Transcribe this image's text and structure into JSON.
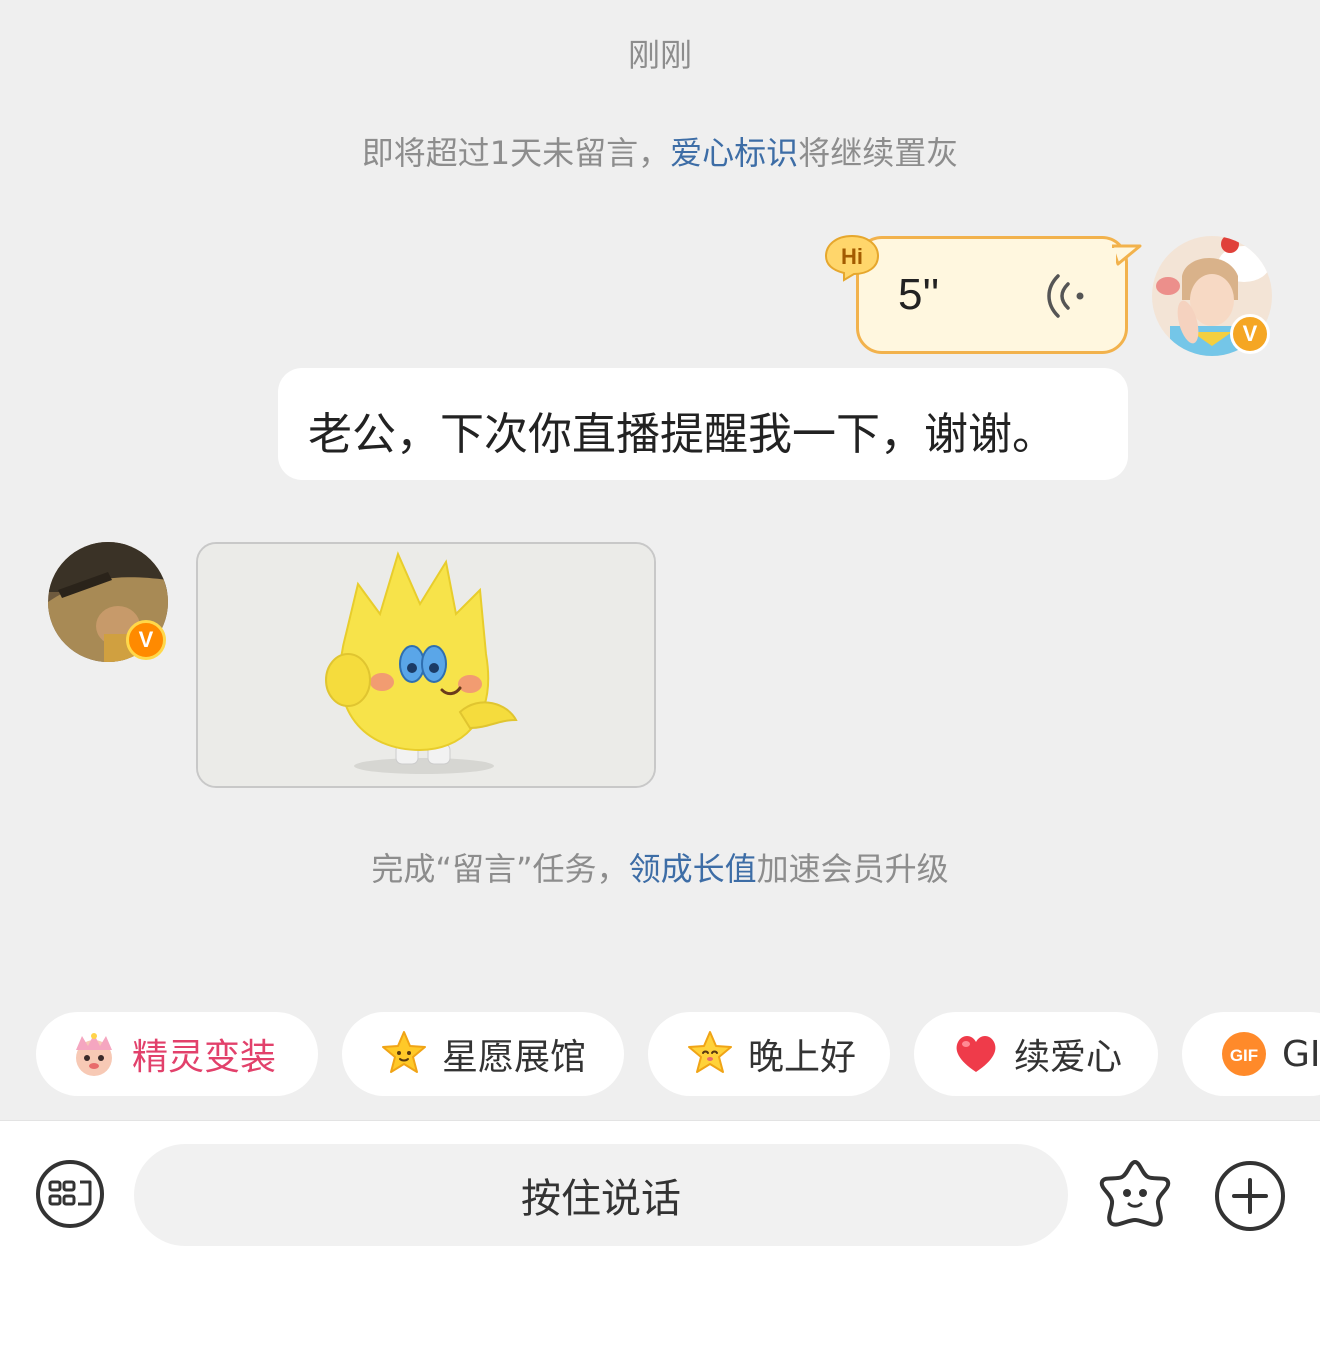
{
  "timestamp": "刚刚",
  "notice": {
    "prefix": "即将超过1天未留言，",
    "link": "爱心标识",
    "suffix": "将继续置灰"
  },
  "messages": {
    "voice": {
      "badge": "Hi",
      "duration": "5''"
    },
    "text": "老公，下次你直播提醒我一下，谢谢。",
    "verify_mark": "V"
  },
  "task_notice": {
    "prefix": "完成“留言”任务，",
    "link": "领成长值",
    "suffix": "加速会员升级"
  },
  "quick_actions": [
    {
      "label": "精灵变装",
      "icon": "sprite-costume-icon"
    },
    {
      "label": "星愿展馆",
      "icon": "star-icon"
    },
    {
      "label": "晚上好",
      "icon": "star-face-icon"
    },
    {
      "label": "续爱心",
      "icon": "heart-icon"
    },
    {
      "label": "GIF",
      "icon": "gif-icon",
      "icon_text": "GIF"
    }
  ],
  "input_bar": {
    "talk_label": "按住说话",
    "left_icon": "keyboard-icon",
    "emoji_icon": "star-emoji-icon",
    "plus_icon": "plus-icon"
  },
  "colors": {
    "background": "#efefef",
    "link": "#3d6da6",
    "voice_bubble": "#fff7df",
    "voice_border": "#f2b24c",
    "chip_accent": "#e2416b"
  }
}
